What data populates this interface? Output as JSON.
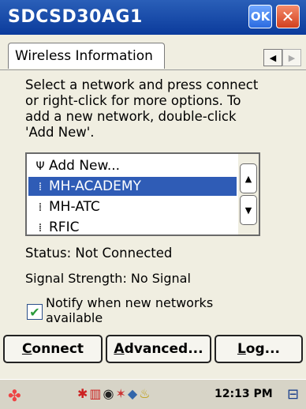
{
  "window": {
    "title": "SDCSD30AG1",
    "ok_label": "OK",
    "close_glyph": "✕"
  },
  "tabs": [
    {
      "label": "Wireless Information",
      "active": true
    }
  ],
  "instructions": "Select a network and press connect\nor right-click for more options.  To\nadd a new network, double-click\n'Add New'.",
  "networks": [
    {
      "label": "Add New...",
      "icon": "antenna-icon",
      "selected": false
    },
    {
      "label": "MH-ACADEMY",
      "icon": "signal-icon",
      "selected": true
    },
    {
      "label": "MH-ATC",
      "icon": "signal-icon",
      "selected": false
    },
    {
      "label": "RFIC",
      "icon": "signal-icon",
      "selected": false
    }
  ],
  "status": {
    "text": "Status:  Not Connected"
  },
  "signal": {
    "text": "Signal Strength:  No Signal"
  },
  "notify": {
    "label": "Notify when new networks available",
    "checked": true
  },
  "buttons": {
    "connect": {
      "mnemonic": "C",
      "rest": "onnect"
    },
    "advanced": {
      "mnemonic": "A",
      "rest": "dvanced..."
    },
    "log": {
      "mnemonic": "L",
      "rest": "og..."
    }
  },
  "taskbar": {
    "clock": "12:13 PM"
  },
  "colors": {
    "title_bar": "#0b3b9c",
    "selection": "#2f5cb6",
    "background": "#f0eee1"
  }
}
